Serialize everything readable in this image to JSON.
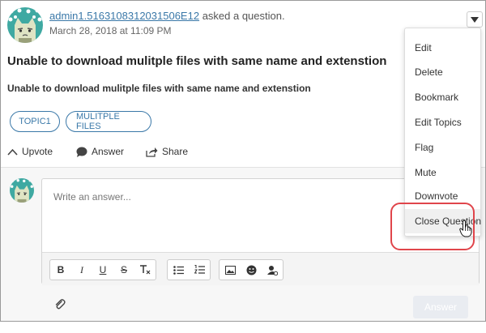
{
  "question": {
    "author": "admin1.5163108312031506E12",
    "action_text": "asked a question.",
    "date": "March 28, 2018 at 11:09 PM",
    "title": "Unable to download mulitple files with same name and extenstion",
    "body": "Unable to download mulitple files with same name and extenstion",
    "topics": [
      "TOPIC1",
      "MULITPLE FILES"
    ]
  },
  "actions": {
    "upvote": "Upvote",
    "answer": "Answer",
    "share": "Share"
  },
  "dropdown": {
    "items": [
      "Edit",
      "Delete",
      "Bookmark",
      "Edit Topics",
      "Flag",
      "Mute",
      "Downvote",
      "Close Question"
    ],
    "hovered": "Close Question"
  },
  "editor": {
    "placeholder": "Write an answer...",
    "submit_label": "Answer"
  },
  "colors": {
    "link": "#3a78a8",
    "highlight_ring": "#e0454b",
    "avatar_bg": "#3fa9a2"
  }
}
